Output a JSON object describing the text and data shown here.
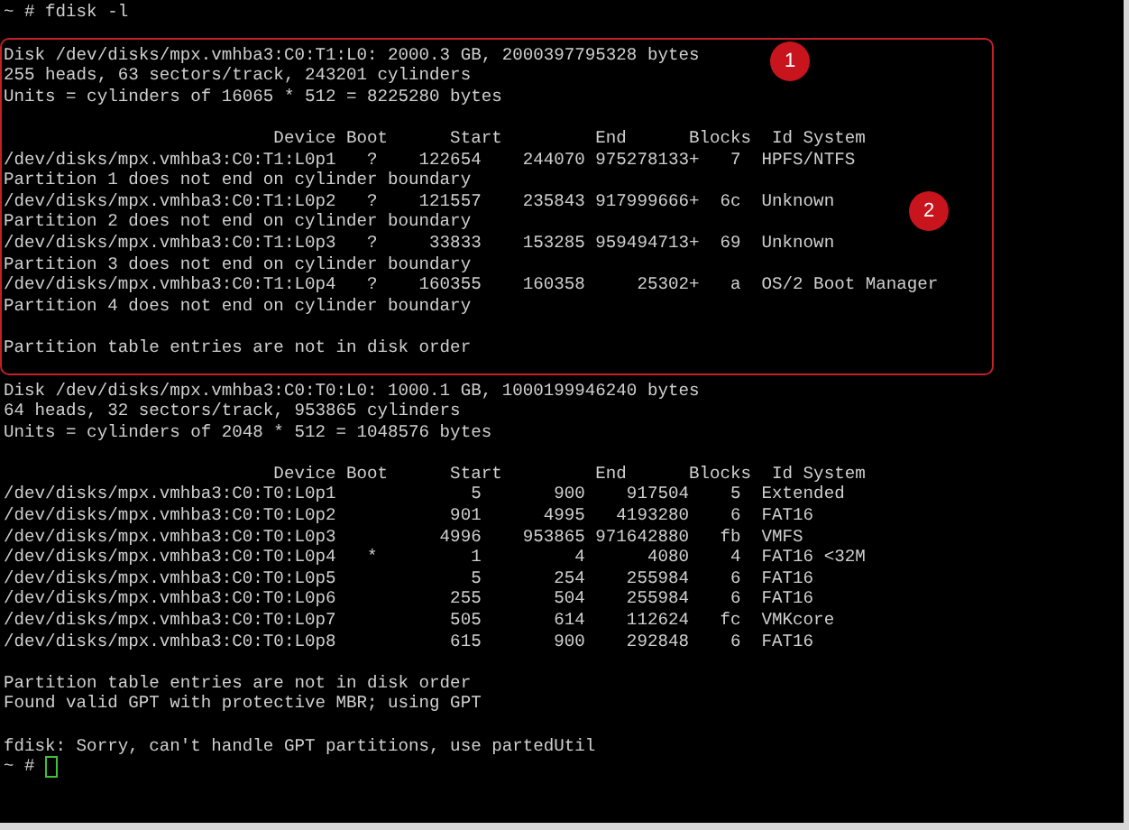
{
  "terminal": {
    "command_line": {
      "prompt": "~ #",
      "command": "fdisk -l"
    },
    "highlight_box": {
      "badges": [
        "1",
        "2"
      ],
      "blocks": [
        [
          "Disk /dev/disks/mpx.vmhba3:C0:T1:L0: 2000.3 GB, 2000397795328 bytes",
          "255 heads, 63 sectors/track, 243201 cylinders",
          "Units = cylinders of 16065 * 512 = 8225280 bytes"
        ],
        [
          "                          Device Boot      Start         End      Blocks  Id System",
          "/dev/disks/mpx.vmhba3:C0:T1:L0p1   ?    122654    244070 975278133+   7  HPFS/NTFS",
          "Partition 1 does not end on cylinder boundary",
          "/dev/disks/mpx.vmhba3:C0:T1:L0p2   ?    121557    235843 917999666+  6c  Unknown",
          "Partition 2 does not end on cylinder boundary",
          "/dev/disks/mpx.vmhba3:C0:T1:L0p3   ?     33833    153285 959494713+  69  Unknown",
          "Partition 3 does not end on cylinder boundary",
          "/dev/disks/mpx.vmhba3:C0:T1:L0p4   ?    160355    160358     25302+   a  OS/2 Boot Manager",
          "Partition 4 does not end on cylinder boundary"
        ],
        [
          "Partition table entries are not in disk order"
        ]
      ]
    },
    "blocks": [
      [
        "Disk /dev/disks/mpx.vmhba3:C0:T0:L0: 1000.1 GB, 1000199946240 bytes",
        "64 heads, 32 sectors/track, 953865 cylinders",
        "Units = cylinders of 2048 * 512 = 1048576 bytes"
      ],
      [
        "                          Device Boot      Start         End      Blocks  Id System",
        "/dev/disks/mpx.vmhba3:C0:T0:L0p1             5       900    917504    5  Extended",
        "/dev/disks/mpx.vmhba3:C0:T0:L0p2           901      4995   4193280    6  FAT16",
        "/dev/disks/mpx.vmhba3:C0:T0:L0p3          4996    953865 971642880   fb  VMFS",
        "/dev/disks/mpx.vmhba3:C0:T0:L0p4   *         1         4      4080    4  FAT16 <32M",
        "/dev/disks/mpx.vmhba3:C0:T0:L0p5             5       254    255984    6  FAT16",
        "/dev/disks/mpx.vmhba3:C0:T0:L0p6           255       504    255984    6  FAT16",
        "/dev/disks/mpx.vmhba3:C0:T0:L0p7           505       614    112624   fc  VMKcore",
        "/dev/disks/mpx.vmhba3:C0:T0:L0p8           615       900    292848    6  FAT16"
      ],
      [
        "Partition table entries are not in disk order",
        "Found valid GPT with protective MBR; using GPT"
      ],
      [
        "fdisk: Sorry, can't handle GPT partitions, use partedUtil"
      ]
    ],
    "final_prompt": {
      "prompt": "~ #",
      "cursor": true
    }
  }
}
